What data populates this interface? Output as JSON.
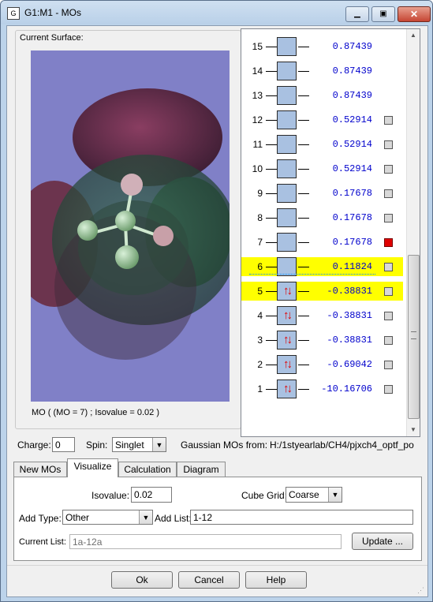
{
  "window": {
    "title": "G1:M1 - MOs",
    "app_icon": "gaussview-icon"
  },
  "surface": {
    "label": "Current Surface:",
    "caption": "MO ( (MO = 7) ; Isovalue = 0.02 )"
  },
  "mo_list": [
    {
      "num": "15",
      "energy": "0.87439",
      "occupied": false,
      "highlight": false,
      "checkbox": "none"
    },
    {
      "num": "14",
      "energy": "0.87439",
      "occupied": false,
      "highlight": false,
      "checkbox": "none"
    },
    {
      "num": "13",
      "energy": "0.87439",
      "occupied": false,
      "highlight": false,
      "checkbox": "none"
    },
    {
      "num": "12",
      "energy": "0.52914",
      "occupied": false,
      "highlight": false,
      "checkbox": "gray"
    },
    {
      "num": "11",
      "energy": "0.52914",
      "occupied": false,
      "highlight": false,
      "checkbox": "gray"
    },
    {
      "num": "10",
      "energy": "0.52914",
      "occupied": false,
      "highlight": false,
      "checkbox": "gray"
    },
    {
      "num": "9",
      "energy": "0.17678",
      "occupied": false,
      "highlight": false,
      "checkbox": "gray"
    },
    {
      "num": "8",
      "energy": "0.17678",
      "occupied": false,
      "highlight": false,
      "checkbox": "gray"
    },
    {
      "num": "7",
      "energy": "0.17678",
      "occupied": false,
      "highlight": false,
      "checkbox": "red"
    },
    {
      "num": "6",
      "energy": "0.11824",
      "occupied": false,
      "highlight": true,
      "checkbox": "gray"
    },
    {
      "num": "5",
      "energy": "-0.38831",
      "occupied": true,
      "highlight": true,
      "checkbox": "gray"
    },
    {
      "num": "4",
      "energy": "-0.38831",
      "occupied": true,
      "highlight": false,
      "checkbox": "gray"
    },
    {
      "num": "3",
      "energy": "-0.38831",
      "occupied": true,
      "highlight": false,
      "checkbox": "gray"
    },
    {
      "num": "2",
      "energy": "-0.69042",
      "occupied": true,
      "highlight": false,
      "checkbox": "gray"
    },
    {
      "num": "1",
      "energy": "-10.16706",
      "occupied": true,
      "highlight": false,
      "checkbox": "gray"
    }
  ],
  "occupied_symbol": "↑↓",
  "charge": {
    "label": "Charge:",
    "value": "0"
  },
  "spin": {
    "label": "Spin:",
    "value": "Singlet"
  },
  "source": {
    "label": "Gaussian MOs from:",
    "path": "H:/1styearlab/CH4/pjxch4_optf_po"
  },
  "tabs": [
    "New MOs",
    "Visualize",
    "Calculation",
    "Diagram"
  ],
  "active_tab": "Visualize",
  "visualize": {
    "isovalue_label": "Isovalue:",
    "isovalue": "0.02",
    "cube_grid_label": "Cube Grid:",
    "cube_grid": "Coarse",
    "add_type_label": "Add Type:",
    "add_type": "Other",
    "add_list_label": "Add List:",
    "add_list": "1-12",
    "current_list_label": "Current List:",
    "current_list": "1a-12a",
    "update_button": "Update ..."
  },
  "buttons": {
    "ok": "Ok",
    "cancel": "Cancel",
    "help": "Help"
  },
  "colors": {
    "highlight": "#ffff00",
    "energy_text": "#0000cc",
    "mo_box": "#a9c1e1",
    "viewport_bg": "#8080c7",
    "selected_check": "#e00000"
  }
}
